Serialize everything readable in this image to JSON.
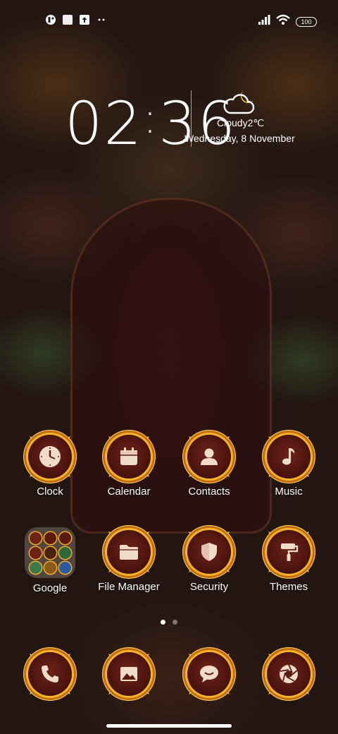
{
  "status_bar": {
    "left_icons": [
      "app-notification-icon",
      "square-notification-icon",
      "upload-notification-icon",
      "more-dots-icon"
    ],
    "battery": "100"
  },
  "clock_widget": {
    "time_hours": "02",
    "time_minutes": "36",
    "weather": "Cloudy2℃",
    "date": "Wednesday, 8 November"
  },
  "apps_row1": [
    {
      "label": "Clock",
      "icon": "clock-icon"
    },
    {
      "label": "Calendar",
      "icon": "calendar-icon"
    },
    {
      "label": "Contacts",
      "icon": "contact-icon"
    },
    {
      "label": "Music",
      "icon": "music-note-icon"
    }
  ],
  "apps_row2": [
    {
      "label": "Google",
      "icon": "folder-icon"
    },
    {
      "label": "File Manager",
      "icon": "folder-icon"
    },
    {
      "label": "Security",
      "icon": "shield-icon"
    },
    {
      "label": "Themes",
      "icon": "paint-roller-icon"
    }
  ],
  "dock": [
    {
      "icon": "phone-icon"
    },
    {
      "icon": "gallery-icon"
    },
    {
      "icon": "message-icon"
    },
    {
      "icon": "camera-shutter-icon"
    }
  ],
  "page_indicator": {
    "count": 2,
    "active": 0
  },
  "colors": {
    "accent_gold": "#f6b42a",
    "icon_bg": "#4d1410"
  }
}
